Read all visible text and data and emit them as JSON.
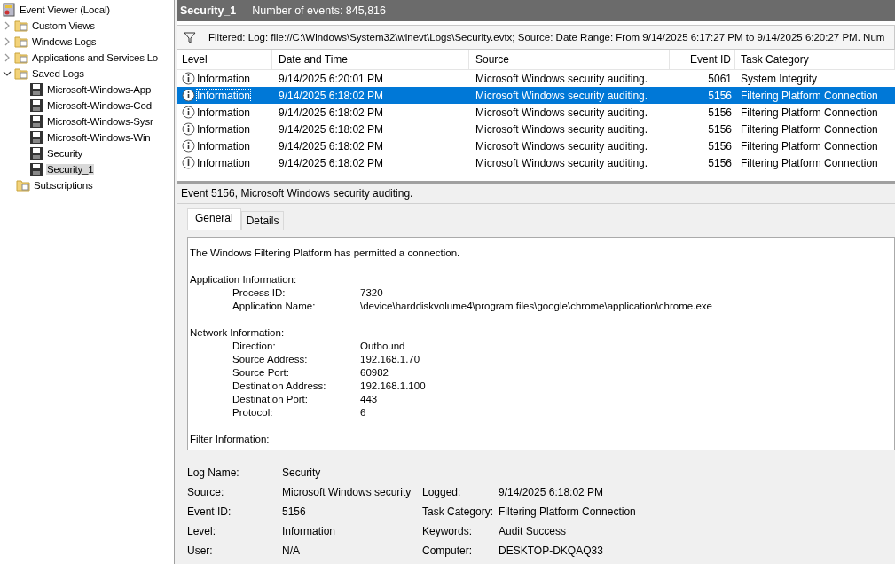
{
  "tree": [
    {
      "label": "Event Viewer (Local)",
      "selected": false,
      "children": [
        {
          "label": "Custom Views",
          "selected": false,
          "expanded": false
        },
        {
          "label": "Windows Logs",
          "selected": false,
          "expanded": false
        },
        {
          "label": "Applications and Services Lo",
          "selected": false,
          "expanded": false
        },
        {
          "label": "Saved Logs",
          "selected": false,
          "expanded": true,
          "children": [
            {
              "label": "Microsoft-Windows-App",
              "selected": false
            },
            {
              "label": "Microsoft-Windows-Cod",
              "selected": false
            },
            {
              "label": "Microsoft-Windows-Sysr",
              "selected": false
            },
            {
              "label": "Microsoft-Windows-Win",
              "selected": false
            },
            {
              "label": "Security",
              "selected": false
            },
            {
              "label": "Security_1",
              "selected": true
            }
          ]
        },
        {
          "label": "Subscriptions",
          "selected": false
        }
      ]
    }
  ],
  "header": {
    "title": "Security_1",
    "count": "Number of events: 845,816"
  },
  "filter": "Filtered: Log: file://C:\\Windows\\System32\\winevt\\Logs\\Security.evtx; Source: Date Range: From 9/14/2025 6:17:27 PM to 9/14/2025 6:20:27 PM. Num",
  "table": {
    "columns": [
      "Level",
      "Date and Time",
      "Source",
      "Event ID",
      "Task Category"
    ],
    "rows": [
      {
        "level": "Information",
        "date": "9/14/2025 6:20:01 PM",
        "source": "Microsoft Windows security auditing.",
        "event_id": "5061",
        "category": "System Integrity",
        "selected": false
      },
      {
        "level": "Information",
        "date": "9/14/2025 6:18:02 PM",
        "source": "Microsoft Windows security auditing.",
        "event_id": "5156",
        "category": "Filtering Platform Connection",
        "selected": true
      },
      {
        "level": "Information",
        "date": "9/14/2025 6:18:02 PM",
        "source": "Microsoft Windows security auditing.",
        "event_id": "5156",
        "category": "Filtering Platform Connection",
        "selected": false
      },
      {
        "level": "Information",
        "date": "9/14/2025 6:18:02 PM",
        "source": "Microsoft Windows security auditing.",
        "event_id": "5156",
        "category": "Filtering Platform Connection",
        "selected": false
      },
      {
        "level": "Information",
        "date": "9/14/2025 6:18:02 PM",
        "source": "Microsoft Windows security auditing.",
        "event_id": "5156",
        "category": "Filtering Platform Connection",
        "selected": false
      },
      {
        "level": "Information",
        "date": "9/14/2025 6:18:02 PM",
        "source": "Microsoft Windows security auditing.",
        "event_id": "5156",
        "category": "Filtering Platform Connection",
        "selected": false
      }
    ]
  },
  "detail": {
    "title": "Event 5156, Microsoft Windows security auditing.",
    "tabs": [
      {
        "label": "General",
        "selected": true
      },
      {
        "label": "Details",
        "selected": false
      }
    ],
    "message": "The Windows Filtering Platform has permitted a connection.",
    "sections": [
      {
        "heading": "Application Information:",
        "fields": [
          {
            "label": "Process ID:",
            "value": "7320"
          },
          {
            "label": "Application Name:",
            "value": "\\device\\harddiskvolume4\\program files\\google\\chrome\\application\\chrome.exe"
          }
        ]
      },
      {
        "heading": "Network Information:",
        "fields": [
          {
            "label": "Direction:",
            "value": "Outbound"
          },
          {
            "label": "Source Address:",
            "value": "192.168.1.70"
          },
          {
            "label": "Source Port:",
            "value": "60982"
          },
          {
            "label": "Destination Address:",
            "value": "192.168.1.100"
          },
          {
            "label": "Destination Port:",
            "value": "443"
          },
          {
            "label": "Protocol:",
            "value": "6"
          }
        ]
      },
      {
        "heading": "Filter Information:"
      }
    ],
    "properties": [
      {
        "label": "Log Name:",
        "value": "Security"
      },
      {
        "label": "Source:",
        "value": "Microsoft Windows security",
        "label2": "Logged:",
        "value2": "9/14/2025 6:18:02 PM"
      },
      {
        "label": "Event ID:",
        "value": "5156",
        "label2": "Task Category:",
        "value2": "Filtering Platform Connection"
      },
      {
        "label": "Level:",
        "value": "Information",
        "label2": "Keywords:",
        "value2": "Audit Success"
      },
      {
        "label": "User:",
        "value": "N/A",
        "label2": "Computer:",
        "value2": "DESKTOP-DKQAQ33"
      }
    ]
  }
}
